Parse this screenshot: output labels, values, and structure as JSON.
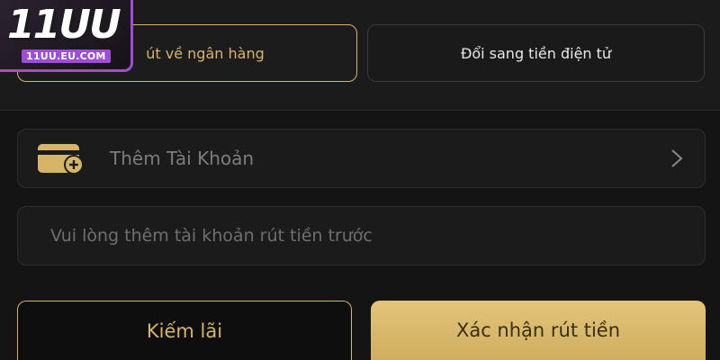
{
  "logo": {
    "main_text": "11UU",
    "sub_text": "11UU.EU.COM"
  },
  "tabs": {
    "bank_label": "Rút về ngân hàng",
    "bank_visible_label": "út về ngân hàng",
    "crypto_label": "Đổi sang tiền điện tử"
  },
  "account_row": {
    "label": "Thêm Tài Khoản",
    "icon": "wallet-add-icon",
    "chevron": "chevron-right-icon"
  },
  "hint": {
    "text": "Vui lòng thêm tài khoản rút tiền trước"
  },
  "actions": {
    "earn_label": "Kiếm lãi",
    "confirm_label": "Xác nhận rút tiền"
  },
  "colors": {
    "accent_gold": "#d7b567",
    "logo_purple": "#a04dd6",
    "background": "#141414"
  }
}
